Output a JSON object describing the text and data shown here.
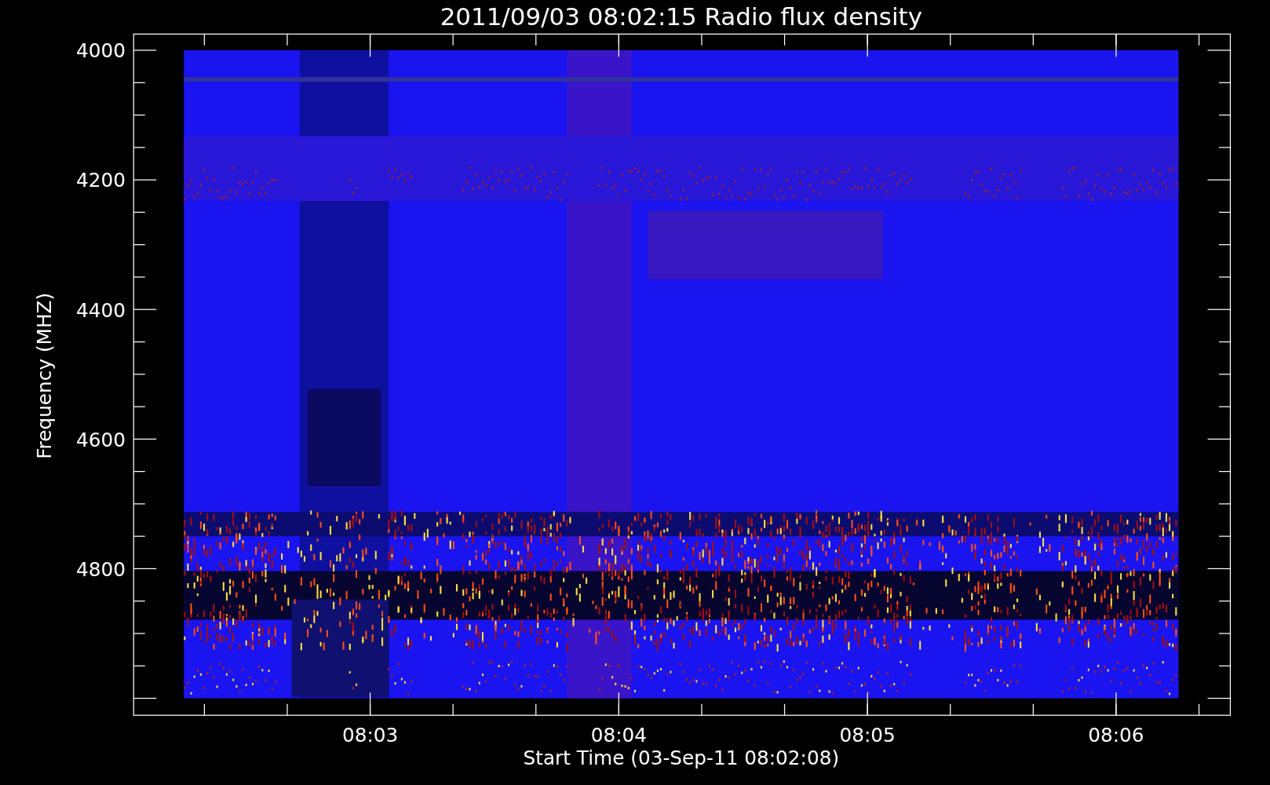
{
  "plot": {
    "title": "2011/09/03 08:02:15 Radio flux density",
    "x_axis": {
      "label": "Start Time (03-Sep-11 08:02:08)",
      "ticks": [
        "08:03",
        "08:04",
        "08:05",
        "08:06"
      ]
    },
    "y_axis": {
      "label": "Frequency (MHZ)",
      "ticks": [
        "4000",
        "4200",
        "4400",
        "4600",
        "4800"
      ]
    }
  }
}
